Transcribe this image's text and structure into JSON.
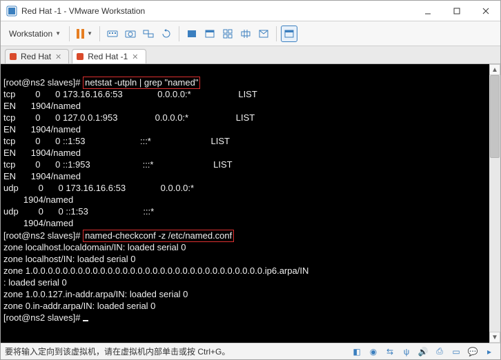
{
  "window": {
    "title": "Red Hat -1 - VMware Workstation"
  },
  "menu": {
    "workstation": "Workstation"
  },
  "tabs": {
    "t1": "Red Hat",
    "t2": "Red Hat -1"
  },
  "terminal": {
    "prompt1": "[root@ns2 slaves]# ",
    "cmd1": "netstat -utpln | grep \"named\"",
    "row1a": "tcp        0      0 173.16.16.6:53              0.0.0.0:*                   LIST",
    "row1b": "EN      1904/named",
    "row2a": "tcp        0      0 127.0.0.1:953               0.0.0.0:*                   LIST",
    "row2b": "EN      1904/named",
    "row3a": "tcp        0      0 ::1:53                      :::*                        LIST",
    "row3b": "EN      1904/named",
    "row4a": "tcp        0      0 ::1:953                     :::*                        LIST",
    "row4b": "EN      1904/named",
    "row5a": "udp        0      0 173.16.16.6:53              0.0.0.0:*",
    "row5b": "        1904/named",
    "row6a": "udp        0      0 ::1:53                      :::*",
    "row6b": "        1904/named",
    "prompt2": "[root@ns2 slaves]# ",
    "cmd2": "named-checkconf -z /etc/named.conf",
    "z1": "zone localhost.localdomain/IN: loaded serial 0",
    "z2": "zone localhost/IN: loaded serial 0",
    "z3": "zone 1.0.0.0.0.0.0.0.0.0.0.0.0.0.0.0.0.0.0.0.0.0.0.0.0.0.0.0.0.0.0.0.ip6.arpa/IN",
    "z3b": ": loaded serial 0",
    "z4": "zone 1.0.0.127.in-addr.arpa/IN: loaded serial 0",
    "z5": "zone 0.in-addr.arpa/IN: loaded serial 0",
    "prompt3": "[root@ns2 slaves]# "
  },
  "status": {
    "text": "要将输入定向到该虚拟机，请在虚拟机内部单击或按 Ctrl+G。"
  }
}
